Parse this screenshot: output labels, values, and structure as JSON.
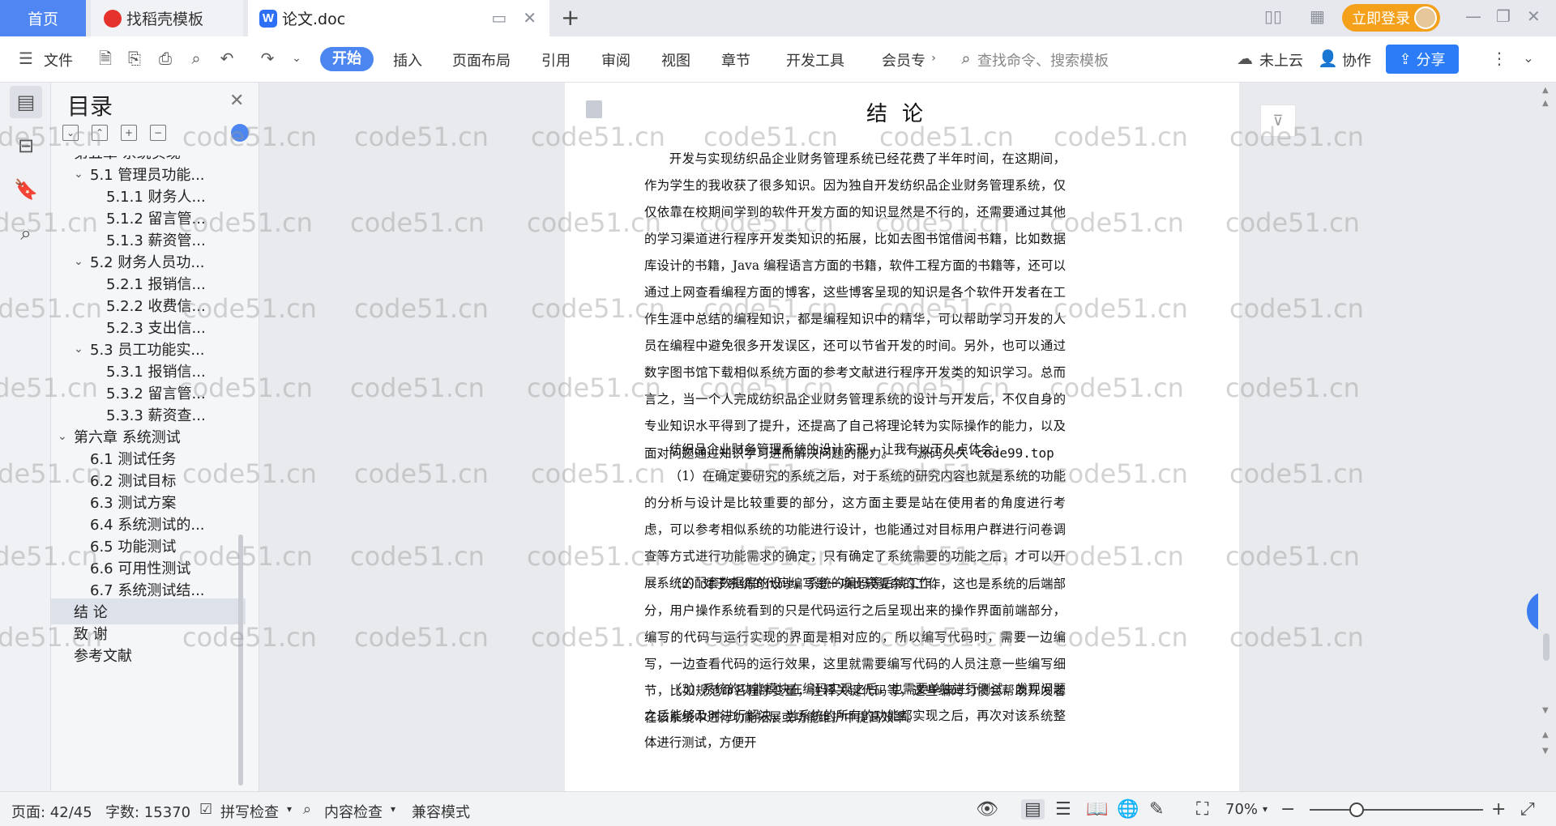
{
  "tabs": {
    "home": "首页",
    "daoke": "找稻壳模板",
    "doc": "论文.doc"
  },
  "titlebar": {
    "login": "立即登录"
  },
  "ribbon": {
    "file": "文件",
    "start": "开始",
    "insert": "插入",
    "layout": "页面布局",
    "reference": "引用",
    "review": "审阅",
    "view": "视图",
    "chapter": "章节",
    "devtools": "开发工具",
    "member": "会员专",
    "search_placeholder": "查找命令、搜索模板",
    "cloud": "未上云",
    "collab": "协作",
    "share": "分享"
  },
  "toc": {
    "title": "目录",
    "items": [
      {
        "label": "第五章 系统实现",
        "level": 1,
        "expand": true
      },
      {
        "label": "5.1 管理员功能...",
        "level": 2,
        "expand": true
      },
      {
        "label": "5.1.1 财务人...",
        "level": 3
      },
      {
        "label": "5.1.2 留言管...",
        "level": 3
      },
      {
        "label": "5.1.3 薪资管...",
        "level": 3
      },
      {
        "label": "5.2 财务人员功...",
        "level": 2,
        "expand": true
      },
      {
        "label": "5.2.1 报销信...",
        "level": 3
      },
      {
        "label": "5.2.2 收费信...",
        "level": 3
      },
      {
        "label": "5.2.3 支出信...",
        "level": 3
      },
      {
        "label": "5.3 员工功能实...",
        "level": 2,
        "expand": true
      },
      {
        "label": "5.3.1 报销信...",
        "level": 3
      },
      {
        "label": "5.3.2 留言管...",
        "level": 3
      },
      {
        "label": "5.3.3 薪资查...",
        "level": 3
      },
      {
        "label": "第六章 系统测试",
        "level": 1,
        "expand": true
      },
      {
        "label": "6.1 测试任务",
        "level": 2
      },
      {
        "label": "6.2 测试目标",
        "level": 2
      },
      {
        "label": "6.3 测试方案",
        "level": 2
      },
      {
        "label": "6.4 系统测试的...",
        "level": 2
      },
      {
        "label": "6.5 功能测试",
        "level": 2
      },
      {
        "label": "6.6 可用性测试",
        "level": 2
      },
      {
        "label": "6.7 系统测试结...",
        "level": 2
      },
      {
        "label": "结 论",
        "level": 1,
        "selected": true
      },
      {
        "label": "致 谢",
        "level": 1
      },
      {
        "label": "参考文献",
        "level": 1
      }
    ]
  },
  "document": {
    "title": "结论",
    "p1": "开发与实现纺织品企业财务管理系统已经花费了半年时间，在这期间，作为学生的我收获了很多知识。因为独自开发纺织品企业财务管理系统，仅仅依靠在校期间学到的软件开发方面的知识显然是不行的，还需要通过其他的学习渠道进行程序开发类知识的拓展，比如去图书馆借阅书籍，比如数据库设计的书籍，Java 编程语言方面的书籍，软件工程方面的书籍等，还可以通过上网查看编程方面的博客，这些博客呈现的知识是各个软件开发者在工作生涯中总结的编程知识，都是编程知识中的精华，可以帮助学习开发的人员在编程中避免很多开发误区，还可以节省开发的时间。另外，也可以通过数字图书馆下载相似系统方面的参考文献进行程序开发类的知识学习。总而言之，当一个人完成纺织品企业财务管理系统的设计与开发后，不仅自身的专业知识水平得到了提升，还提高了自己将理论转为实际操作的能力，以及面对问题通过知识学习进而解决问题的能力。",
    "p1_src": "源码久久-code99.top",
    "p2": "纺织品企业财务管理系统的设计实现，让我有以下几点体会：",
    "p3": "（1）在确定要研究的系统之后，对于系统的研究内容也就是系统的功能的分析与设计是比较重要的部分，这方面主要是站在使用者的角度进行考虑，可以参考相似系统的功能进行设计，也能通过对目标用户群进行问卷调查等方式进行功能需求的确定，只有确定了系统需要的功能之后，才可以开展系统的配套数据库的设计，系统的编码等后续工作。",
    "p4": "（2）对于系统的代码编写是一项比较复杂的工作，这也是系统的后端部分，用户操作系统看到的只是代码运行之后呈现出来的操作界面前端部分，编写的代码与运行实现的界面是相对应的，所以编写代码时，需要一边编写，一边查看代码的运行效果，这里就需要编写代码的人员注意一些编写细节，比如规范命名程序变量，注释关键代码等，这些编码习惯会帮助开发者在该系统中进行功能拓展或功能维护中提高效率。",
    "p5": "（3）系统的功能模块在编码实现之后，也需要单独进行测试，发现问题之后能够及时进行解决，当系统的所有的功能都实现之后，再次对该系统整体进行测试，方便开"
  },
  "watermark": "code51.cn",
  "status": {
    "page": "页面: 42/45",
    "words": "字数: 15370",
    "spell": "拼写检查",
    "content": "内容检查",
    "compat": "兼容模式",
    "zoom": "70%",
    "zoom_level": 0.27
  },
  "colors": {
    "accent": "#4c86f0",
    "login": "#f4a01b",
    "share": "#2b7cf6"
  }
}
